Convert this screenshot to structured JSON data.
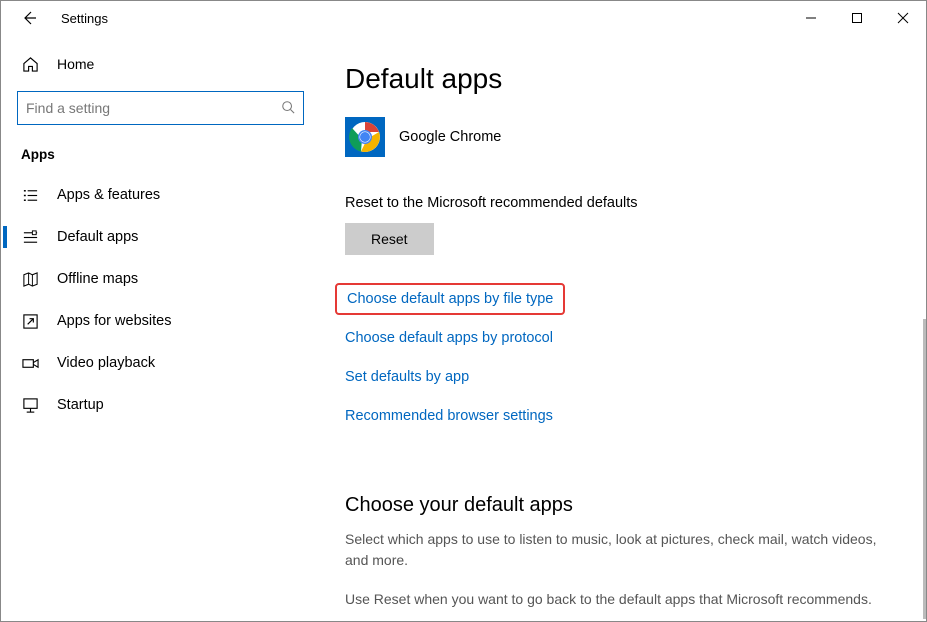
{
  "titlebar": {
    "title": "Settings"
  },
  "sidebar": {
    "home_label": "Home",
    "search_placeholder": "Find a setting",
    "section_label": "Apps",
    "items": [
      {
        "label": "Apps & features"
      },
      {
        "label": "Default apps"
      },
      {
        "label": "Offline maps"
      },
      {
        "label": "Apps for websites"
      },
      {
        "label": "Video playback"
      },
      {
        "label": "Startup"
      }
    ]
  },
  "main": {
    "heading": "Default apps",
    "current_app": "Google Chrome",
    "reset_label_text": "Reset to the Microsoft recommended defaults",
    "reset_button": "Reset",
    "links": {
      "by_file_type": "Choose default apps by file type",
      "by_protocol": "Choose default apps by protocol",
      "by_app": "Set defaults by app",
      "browser_rec": "Recommended browser settings"
    },
    "sub_heading": "Choose your default apps",
    "desc1": "Select which apps to use to listen to music, look at pictures, check mail, watch videos, and more.",
    "desc2": "Use Reset when you want to go back to the default apps that Microsoft recommends."
  }
}
